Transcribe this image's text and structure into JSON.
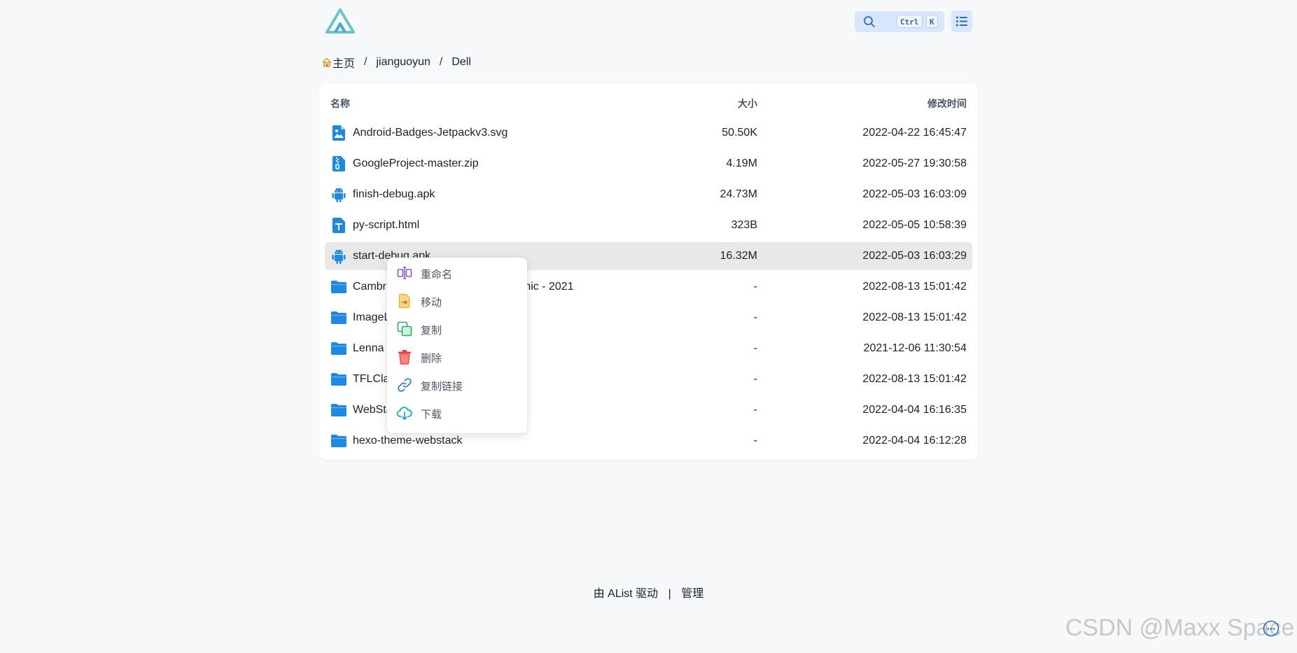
{
  "search": {
    "keys": [
      "Ctrl",
      "K"
    ]
  },
  "breadcrumb": {
    "items": [
      "主页",
      "jianguoyun",
      "Dell"
    ],
    "separator": "/"
  },
  "table": {
    "headers": {
      "name": "名称",
      "size": "大小",
      "modified": "修改时间"
    },
    "rows": [
      {
        "name": "Android-Badges-Jetpackv3.svg",
        "size": "50.50K",
        "modified": "2022-04-22 16:45:47",
        "icon": "image-file-icon"
      },
      {
        "name": "GoogleProject-master.zip",
        "size": "4.19M",
        "modified": "2022-05-27 19:30:58",
        "icon": "zip-file-icon"
      },
      {
        "name": "finish-debug.apk",
        "size": "24.73M",
        "modified": "2022-05-03 16:03:09",
        "icon": "android-icon"
      },
      {
        "name": "py-script.html",
        "size": "323B",
        "modified": "2022-05-05 10:58:39",
        "icon": "text-file-icon"
      },
      {
        "name": "start-debug.apk",
        "size": "16.32M",
        "modified": "2022-05-03 16:03:29",
        "icon": "android-icon"
      },
      {
        "name": "Cambr",
        "name_tail": "emic - 2021",
        "size": "-",
        "modified": "2022-08-13 15:01:42",
        "icon": "folder-icon"
      },
      {
        "name": "ImageL",
        "size": "-",
        "modified": "2022-08-13 15:01:42",
        "icon": "folder-icon"
      },
      {
        "name": "Lenna",
        "size": "-",
        "modified": "2021-12-06 11:30:54",
        "icon": "folder-icon"
      },
      {
        "name": "TFLCla",
        "size": "-",
        "modified": "2022-08-13 15:01:42",
        "icon": "folder-icon"
      },
      {
        "name": "WebSta",
        "size": "-",
        "modified": "2022-04-04 16:16:35",
        "icon": "folder-icon"
      },
      {
        "name": "hexo-theme-webstack",
        "size": "-",
        "modified": "2022-04-04 16:12:28",
        "icon": "folder-icon"
      }
    ]
  },
  "context_menu": {
    "items": [
      {
        "label": "重命名",
        "icon": "rename-icon",
        "color": "#805ad5"
      },
      {
        "label": "移动",
        "icon": "move-icon",
        "color": "#ecb22e"
      },
      {
        "label": "复制",
        "icon": "copy-icon",
        "color": "#38a169"
      },
      {
        "label": "删除",
        "icon": "delete-icon",
        "color": "#e53e3e"
      },
      {
        "label": "复制链接",
        "icon": "link-icon",
        "color": "#3182ce"
      },
      {
        "label": "下载",
        "icon": "download-icon",
        "color": "#00a3c4"
      }
    ]
  },
  "footer": {
    "powered": "由 AList 驱动",
    "separator": "|",
    "manage": "管理"
  },
  "watermark": "CSDN @Maxx Space",
  "colors": {
    "accent": "#1e88e5",
    "hover_row": "#e8e8e8",
    "page_bg": "#f7f8fa"
  }
}
